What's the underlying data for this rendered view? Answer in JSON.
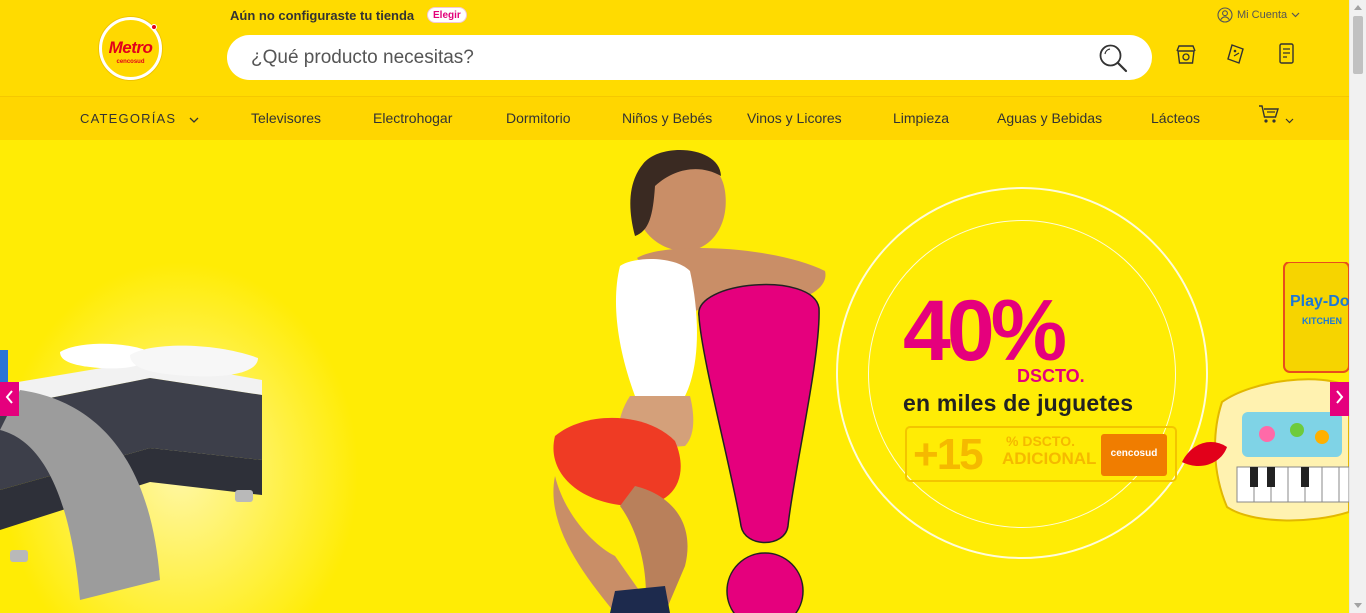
{
  "header": {
    "logo": {
      "brand": "Metro",
      "sub": "cencosud"
    },
    "store_message": "Aún no configuraste tu tienda",
    "store_button": "Elegir",
    "account_label": "Mi Cuenta",
    "search": {
      "placeholder": "¿Qué producto necesitas?",
      "value": ""
    },
    "icons": [
      "store-locator-icon",
      "coupon-icon",
      "shopping-list-icon"
    ]
  },
  "nav": {
    "categories_label": "CATEGORÍAS",
    "items": [
      "Televisores",
      "Electrohogar",
      "Dormitorio",
      "Niños y Bebés",
      "Vinos y Licores",
      "Limpieza",
      "Aguas y Bebidas",
      "Lácteos"
    ],
    "cart_icon": "cart-icon"
  },
  "hero": {
    "discount": "40%",
    "discount_suffix": "DSCTO.",
    "headline": "en miles de juguetes",
    "extra_value": "+15",
    "extra_line1": "% DSCTO.",
    "extra_line2": "ADICIONAL",
    "card_label": "cencosud",
    "toy_brand": "Play-Doh",
    "toy_sub": "KITCHEN",
    "colors": {
      "magenta": "#e5007d",
      "yellow": "#ffec05",
      "header_yellow": "#ffdb00"
    }
  }
}
